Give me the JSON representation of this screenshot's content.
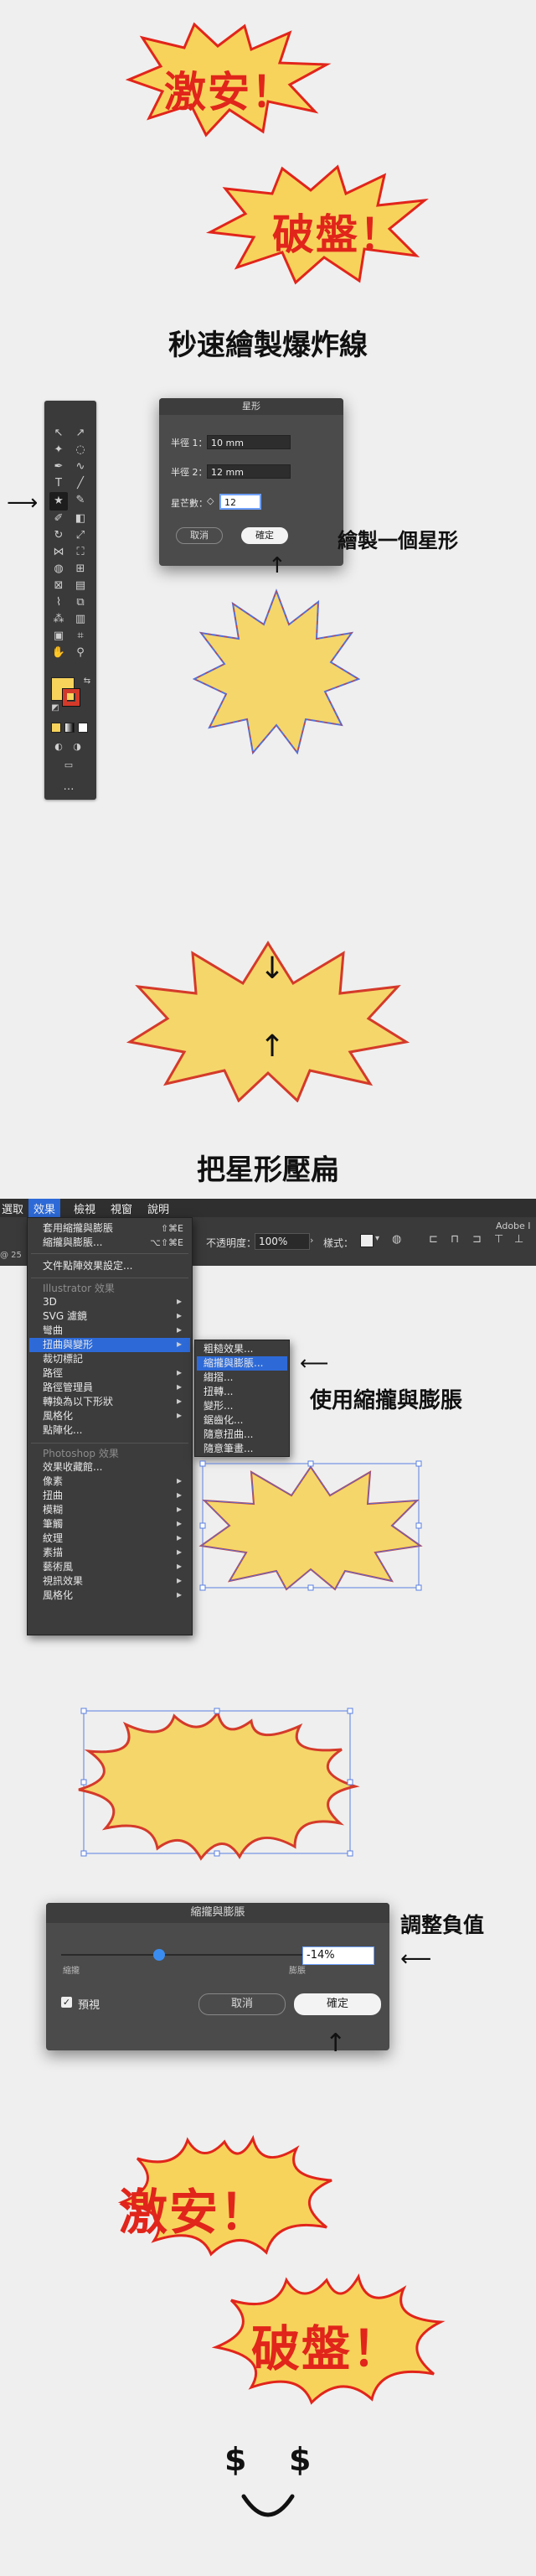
{
  "colors": {
    "accent_red": "#e1251b",
    "burst_yellow": "#f7d35c",
    "star_fill": "#f5d66a",
    "star_stroke_blue": "#5570d8",
    "star_stroke_red": "#d43a2a",
    "menu_highlight": "#2d6ad8",
    "dark_panel": "#3c3c3c"
  },
  "hero": {
    "word1": "激安！",
    "word2": "破盤！"
  },
  "section1": {
    "title": "秒速繪製爆炸線"
  },
  "star_dialog": {
    "title": "星形",
    "radius1_label": "半徑 1：",
    "radius1_value": "10 mm",
    "radius2_label": "半徑 2：",
    "radius2_value": "12 mm",
    "points_label": "星芒數：",
    "points_value": "12",
    "cancel": "取消",
    "ok": "確定",
    "annotation": "繪製一個星形"
  },
  "section2": {
    "title": "把星形壓扁"
  },
  "menubar": {
    "items": [
      "選取",
      "效果",
      "檢視",
      "視窗",
      "說明"
    ],
    "active": "效果"
  },
  "effect_menu": {
    "apply_last": "套用縮攏與膨脹",
    "apply_last_shortcut": "⇧⌘E",
    "last_effect": "縮攏與膨脹...",
    "last_effect_shortcut": "⌥⇧⌘E",
    "doc_raster": "文件點陣效果設定...",
    "illustrator_header": "Illustrator 效果",
    "illustrator_items": [
      "3D",
      "SVG 濾鏡",
      "彎曲",
      "扭曲與變形",
      "裁切標記",
      "路徑",
      "路徑管理員",
      "轉換為以下形狀",
      "風格化",
      "點陣化..."
    ],
    "photoshop_header": "Photoshop 效果",
    "photoshop_items": [
      "效果收藏館...",
      "像素",
      "扭曲",
      "模糊",
      "筆觸",
      "紋理",
      "素描",
      "藝術風",
      "視訊效果",
      "風格化"
    ]
  },
  "distort_submenu": {
    "items": [
      "粗糙效果...",
      "縮攏與膨脹...",
      "縐摺...",
      "扭轉...",
      "變形...",
      "鋸齒化...",
      "隨意扭曲...",
      "隨意筆畫..."
    ],
    "highlighted": "縮攏與膨脹..."
  },
  "control_bar": {
    "opacity_label": "不透明度：",
    "opacity_value": "100%",
    "style_label": "樣式：",
    "app_label": "Adobe I",
    "zoom_label": "@ 25"
  },
  "menu_annotation": "使用縮攏與膨脹",
  "pucker_dialog": {
    "title": "縮攏與膨脹",
    "left_label": "縮攏",
    "right_label": "膨脹",
    "value": "-14%",
    "preview_label": "預視",
    "cancel": "取消",
    "ok": "確定",
    "annotation": "調整負值",
    "slider_fraction": 0.39
  },
  "footer": {
    "dollar1": "$",
    "dollar2": "$"
  }
}
